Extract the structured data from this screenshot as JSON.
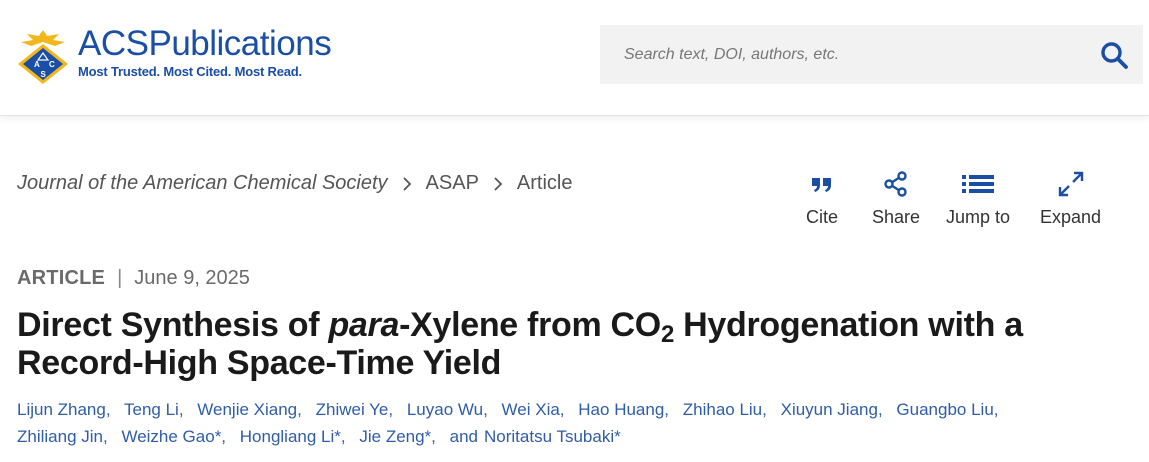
{
  "header": {
    "logo": {
      "brand": "ACS",
      "brand_suffix": "Publications",
      "tagline": "Most Trusted. Most Cited. Most Read.",
      "emblem_letters": [
        "A",
        "C",
        "S"
      ],
      "brand_color": "#1b4ea5",
      "emblem_color": "#f2b71b"
    },
    "search": {
      "placeholder": "Search text, DOI, authors, etc.",
      "icon": "search-icon",
      "icon_color": "#1b4ea5"
    }
  },
  "breadcrumb": [
    {
      "label": "Journal of the American Chemical Society"
    },
    {
      "label": "ASAP"
    },
    {
      "label": "Article"
    }
  ],
  "actions": [
    {
      "label": "Cite",
      "icon": "quote-icon"
    },
    {
      "label": "Share",
      "icon": "share-icon"
    },
    {
      "label": "Jump to",
      "icon": "list-icon"
    },
    {
      "label": "Expand",
      "icon": "expand-icon"
    }
  ],
  "article": {
    "type": "ARTICLE",
    "separator": "|",
    "date": "June 9, 2025",
    "title": {
      "part1": "Direct Synthesis of ",
      "italic": "para",
      "part2": "-Xylene from CO",
      "subscript": "2",
      "part3": " Hydrogenation with a Record-High Space-Time Yield"
    },
    "authors": [
      "Lijun Zhang,",
      "Teng Li,",
      "Wenjie Xiang,",
      "Zhiwei Ye,",
      "Luyao Wu,",
      "Wei Xia,",
      "Hao Huang,",
      "Zhihao Liu,",
      "Xiuyun Jiang,",
      "Guangbo Liu,",
      "Zhiliang Jin,",
      "Weizhe Gao*,",
      "Hongliang Li*,",
      "Jie Zeng*,"
    ],
    "and_word": "and",
    "last_author": "Noritatsu Tsubaki*"
  },
  "colors": {
    "link": "#2f5da8",
    "icon": "#1b4ea5"
  }
}
